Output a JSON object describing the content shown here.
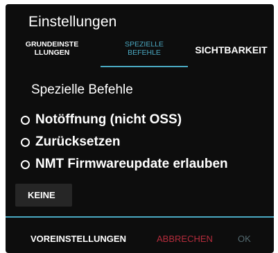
{
  "dialog": {
    "title": "Einstellungen"
  },
  "tabs": [
    {
      "label": "GRUNDEINSTELLUNGEN",
      "state": "normal"
    },
    {
      "label": "SPEZIELLE BEFEHLE",
      "state": "selected"
    },
    {
      "label": "SICHTBARKEIT",
      "state": "normal"
    }
  ],
  "section": {
    "title": "Spezielle Befehle"
  },
  "options": [
    {
      "label": "Notöffnung (nicht OSS)",
      "selected": false
    },
    {
      "label": "Zurücksetzen",
      "selected": false
    },
    {
      "label": "NMT Firmwareupdate erlauben",
      "selected": false
    }
  ],
  "keine_label": "KEINE",
  "footer": {
    "presets_label": "VOREINSTELLUNGEN",
    "cancel_label": "ABBRECHEN",
    "ok_label": "OK"
  },
  "colors": {
    "background": "#0d0d0d",
    "accent": "#4aa9c2",
    "cancel": "#b52c3c",
    "ok_disabled": "#546a70",
    "button_bg": "#262626"
  }
}
